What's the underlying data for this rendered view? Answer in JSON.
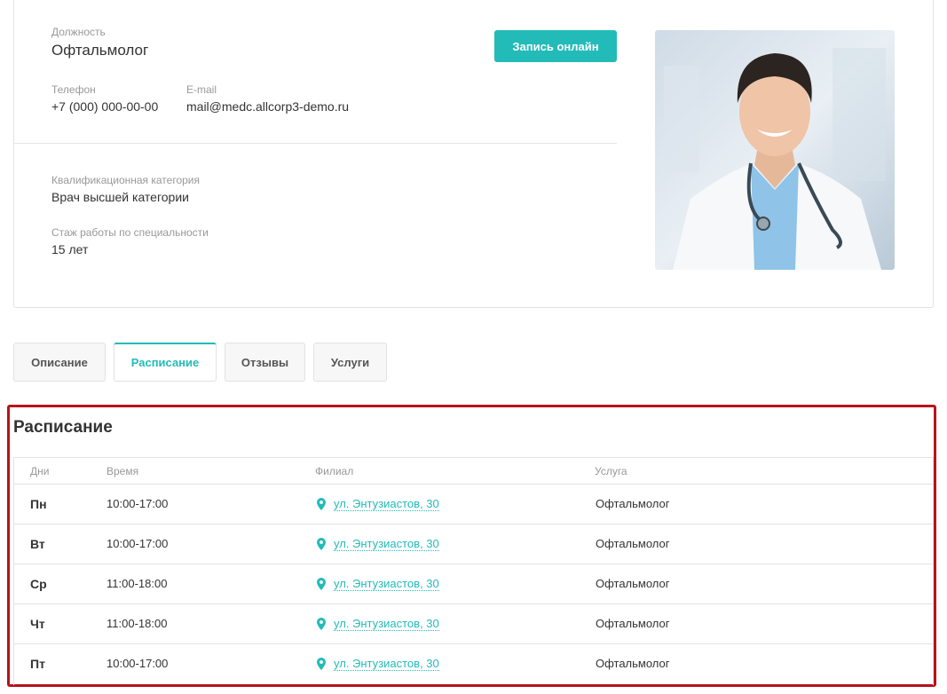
{
  "doctor": {
    "position_label": "Должность",
    "position_value": "Офтальмолог",
    "phone_label": "Телефон",
    "phone_value": "+7 (000) 000-00-00",
    "email_label": "E-mail",
    "email_value": "mail@medc.allcorp3-demo.ru",
    "qualification_label": "Квалификационная категория",
    "qualification_value": "Врач высшей категории",
    "experience_label": "Стаж работы по специальности",
    "experience_value": "15 лет",
    "online_button": "Запись онлайн"
  },
  "tabs": [
    {
      "label": "Описание",
      "active": false
    },
    {
      "label": "Расписание",
      "active": true
    },
    {
      "label": "Отзывы",
      "active": false
    },
    {
      "label": "Услуги",
      "active": false
    }
  ],
  "schedule": {
    "title": "Расписание",
    "headers": {
      "day": "Дни",
      "time": "Время",
      "branch": "Филиал",
      "service": "Услуга"
    },
    "rows": [
      {
        "day": "Пн",
        "time": "10:00-17:00",
        "branch": "ул. Энтузиастов, 30",
        "service": "Офтальмолог"
      },
      {
        "day": "Вт",
        "time": "10:00-17:00",
        "branch": "ул. Энтузиастов, 30",
        "service": "Офтальмолог"
      },
      {
        "day": "Ср",
        "time": "11:00-18:00",
        "branch": "ул. Энтузиастов, 30",
        "service": "Офтальмолог"
      },
      {
        "day": "Чт",
        "time": "11:00-18:00",
        "branch": "ул. Энтузиастов, 30",
        "service": "Офтальмолог"
      },
      {
        "day": "Пт",
        "time": "10:00-17:00",
        "branch": "ул. Энтузиастов, 30",
        "service": "Офтальмолог"
      }
    ]
  },
  "colors": {
    "accent": "#23bbb8",
    "highlight_border": "#b8121a"
  }
}
